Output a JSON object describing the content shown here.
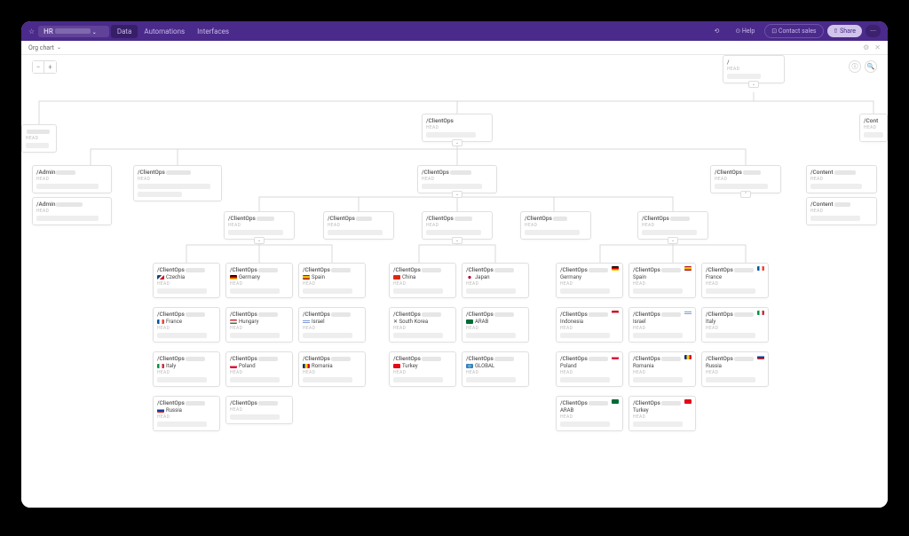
{
  "topbar": {
    "star": "☆",
    "title": "HR",
    "tabs": [
      "Data",
      "Automations",
      "Interfaces"
    ],
    "active_tab": 0,
    "history": "⟲",
    "help": "⊙ Help",
    "contact": "⊡ Contact sales",
    "share": "⇧ Share",
    "more": "⋯"
  },
  "subbar": {
    "view": "Org chart",
    "chevron": "⌄",
    "gear": "⚙",
    "close": "✕"
  },
  "zoom": {
    "minus": "−",
    "plus": "+"
  },
  "toolright": {
    "info": "ⓘ",
    "search": "🔍"
  },
  "labels": {
    "head": "HEAD"
  },
  "root": {
    "title": "/"
  },
  "lvl1": {
    "partial1": "",
    "clientops": "/ClientOps",
    "content": "/Cont"
  },
  "lvl2": {
    "adminA": "/Admin",
    "adminB": "/Admin",
    "coA": "/ClientOps",
    "coB": "/ClientOps",
    "coC": "/ClientOps",
    "contA": "/Content",
    "contB": "/Content"
  },
  "lvl3": {
    "a": "/ClientOps",
    "b": "/ClientOps",
    "c": "/ClientOps",
    "d": "/ClientOps",
    "e": "/ClientOps"
  },
  "grid": {
    "title_prefix": "/ClientOps",
    "cA": [
      {
        "country": "Czechia",
        "flag": "fl-cz"
      },
      {
        "country": "France",
        "flag": "fl-fr"
      },
      {
        "country": "Italy",
        "flag": "fl-it"
      },
      {
        "country": "Russia",
        "flag": "fl-ru"
      }
    ],
    "cB": [
      {
        "country": "Germany",
        "flag": "fl-de"
      },
      {
        "country": "Hungary",
        "flag": "fl-hu"
      },
      {
        "country": "Poland",
        "flag": "fl-pl"
      },
      {
        "country": "",
        "noflag": true
      }
    ],
    "cC": [
      {
        "country": "Spain",
        "flag": "fl-es"
      },
      {
        "country": "Israel",
        "flag": "fl-il"
      },
      {
        "country": "Romania",
        "flag": "fl-ro"
      }
    ],
    "cD": [
      {
        "country": "China",
        "flag": "fl-cn"
      },
      {
        "country": "✕ South Korea",
        "noflag": true
      },
      {
        "country": "Turkey",
        "flag": "fl-tr"
      }
    ],
    "cE": [
      {
        "country": "Japan",
        "flag": "fl-jp",
        "prefix": "•"
      },
      {
        "country": "ARAB",
        "flag": "fl-sa"
      },
      {
        "country": "GLOBAL",
        "flag": "fl-gl"
      }
    ],
    "cF": [
      {
        "country": "Germany",
        "rflag": "fl-de"
      },
      {
        "country": "Indonesia",
        "rflag": "fl-id"
      },
      {
        "country": "Poland",
        "rflag": "fl-pl"
      },
      {
        "country": "ARAB",
        "rflag": "fl-sa"
      }
    ],
    "cG": [
      {
        "country": "Spain",
        "rflag": "fl-es"
      },
      {
        "country": "Israel",
        "rflag": "fl-il"
      },
      {
        "country": "Romania",
        "rflag": "fl-ro"
      },
      {
        "country": "Turkey",
        "rflag": "fl-tr"
      }
    ],
    "cH": [
      {
        "country": "France",
        "rflag": "fl-fr"
      },
      {
        "country": "Italy",
        "rflag": "fl-it"
      },
      {
        "country": "Russia",
        "rflag": "fl-ru"
      }
    ]
  }
}
